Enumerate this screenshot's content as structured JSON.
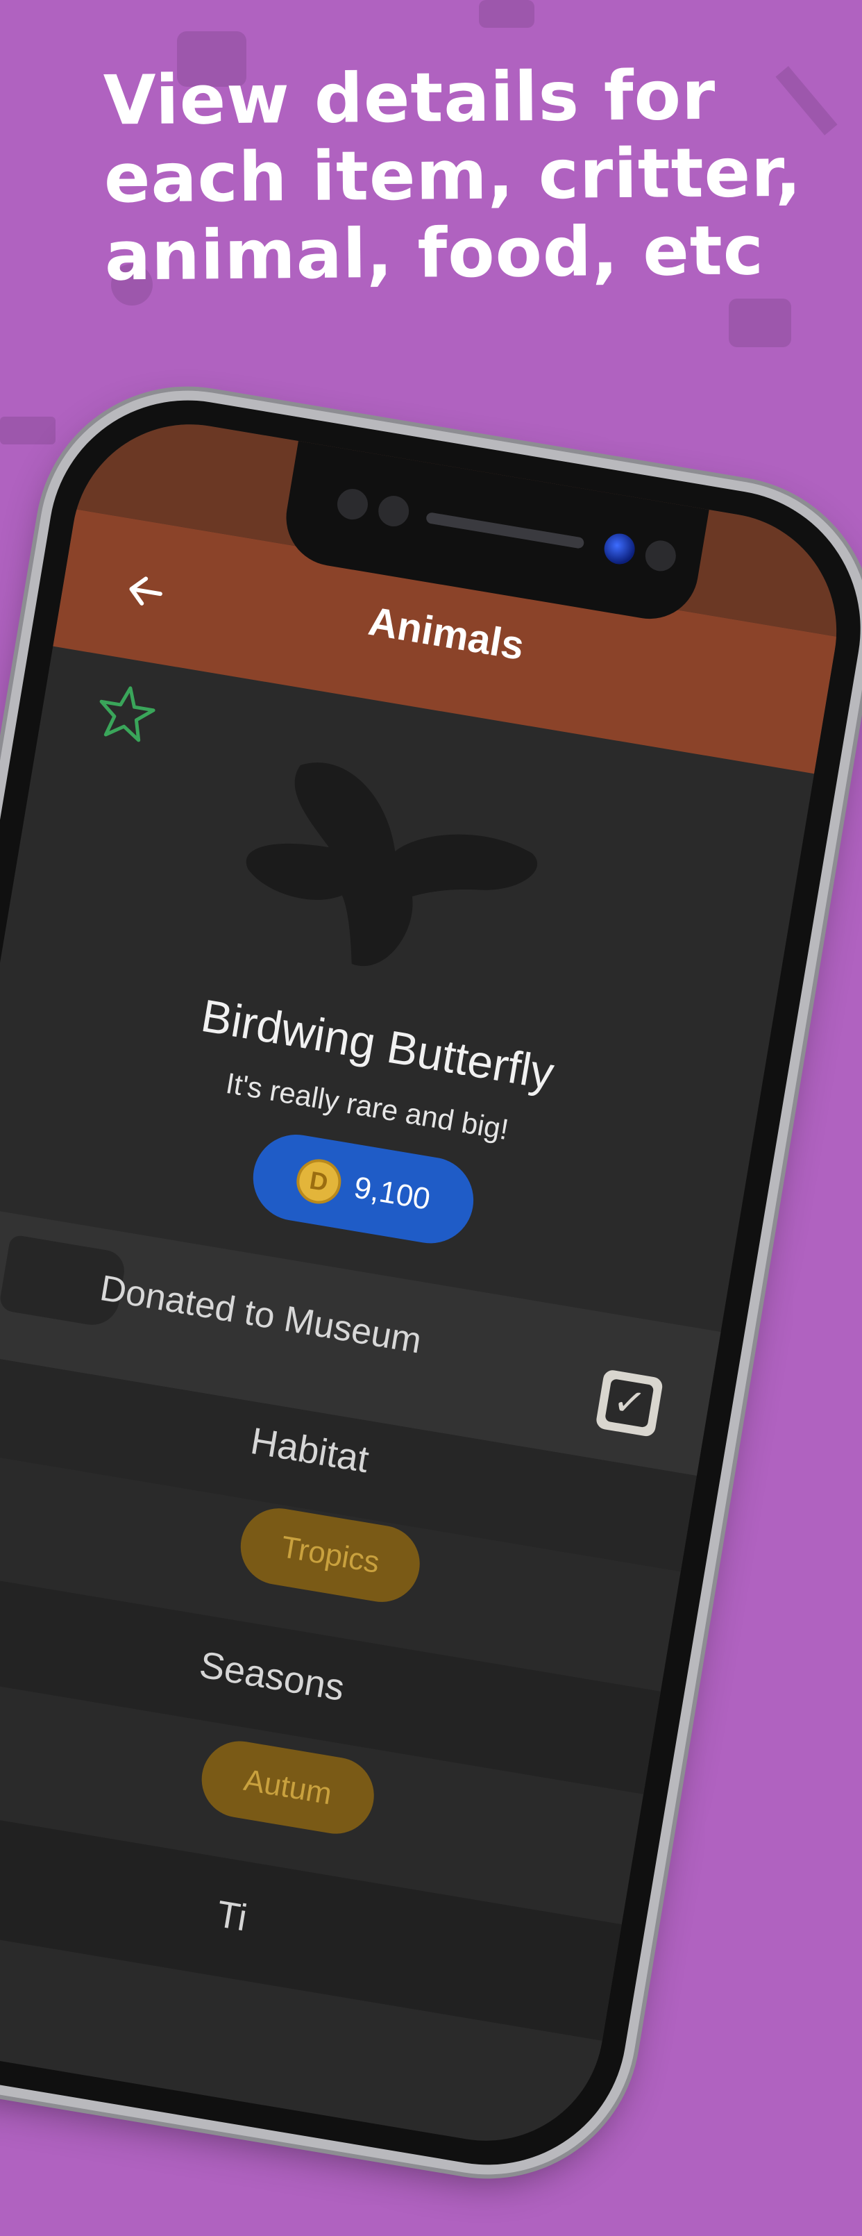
{
  "headline": {
    "line1": "View details for",
    "line2": "each item, critter,",
    "line3": "animal, food, etc"
  },
  "app_bar": {
    "back_icon": "arrow-left-icon",
    "title": "Animals"
  },
  "favorite_icon": "star-outline-icon",
  "item": {
    "name": "Birdwing Butterfly",
    "description": "It's really rare and big!",
    "price": "9,100",
    "price_icon": "coin-icon",
    "coin_letter": "D"
  },
  "museum": {
    "label": "Donated to Museum",
    "checked": true
  },
  "habitat": {
    "title": "Habitat",
    "value": "Tropics"
  },
  "seasons": {
    "title": "Seasons",
    "value": "Autum"
  },
  "next_section_partial": "Ti",
  "colors": {
    "background": "#b062c0",
    "app_bar": "#8b4329",
    "status_bar": "#6b3824",
    "screen": "#2a2a2a",
    "price_pill": "#1f5cc7",
    "chip": "#7a5a16",
    "star": "#3aa55a"
  }
}
